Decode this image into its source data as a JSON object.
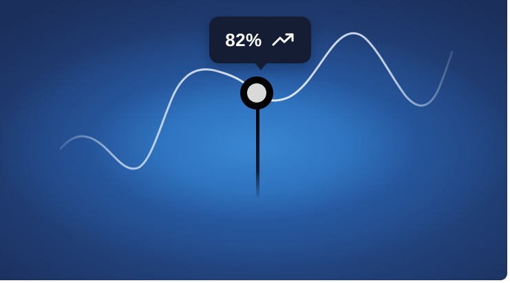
{
  "tooltip": {
    "value": "82%",
    "trend_icon": "trending-up-icon"
  },
  "chart_data": {
    "type": "line",
    "series": [
      {
        "values": [
          0.42,
          0.25,
          0.72,
          0.62,
          0.8,
          0.49,
          0.55
        ]
      }
    ],
    "highlighted_value": "82%"
  },
  "colors": {
    "background_dark": "#1b2f5c",
    "background_glow": "#3a86d2",
    "tooltip_bg": "#141d33",
    "line": "#dfe9f6",
    "marker_fill": "#d9d9d9",
    "marker_ring": "#000000"
  }
}
